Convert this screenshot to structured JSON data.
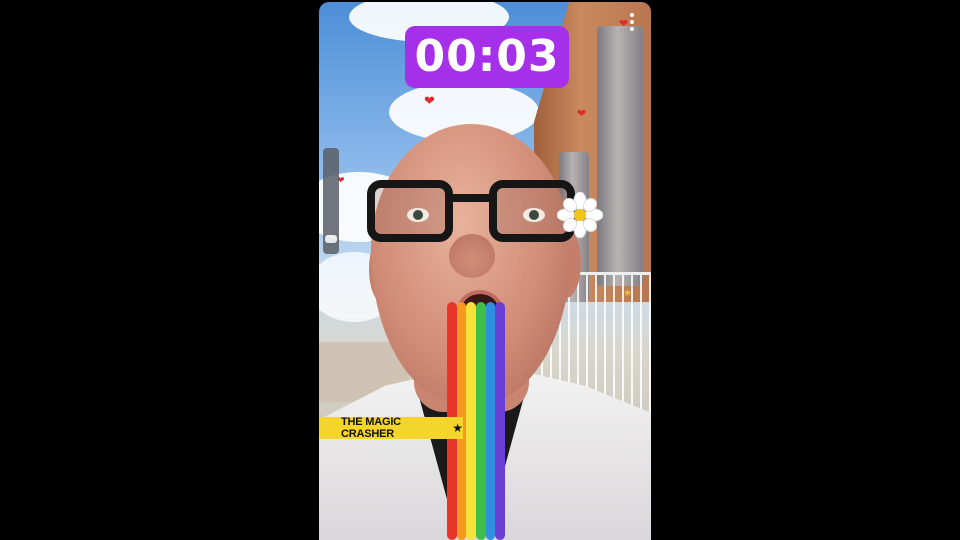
{
  "camera": {
    "timer": "00:03",
    "timer_color": "#a630ea",
    "menu_icon": "more-vertical-icon",
    "lens_name": "THE MAGIC CRASHER",
    "lens_badge_icon": "star-icon",
    "banner_color": "#f4d52b",
    "zoom_level": 0.1,
    "rainbow_colors": [
      "#e8362b",
      "#f59a1c",
      "#f7e23a",
      "#3fbf4a",
      "#2f8fe0",
      "#6a3fd3"
    ]
  }
}
